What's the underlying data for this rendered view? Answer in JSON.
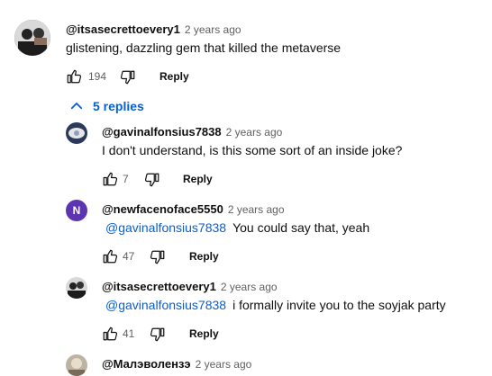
{
  "main_comment": {
    "author": "@itsasecrettoevery1",
    "time": "2 years ago",
    "text": "glistening, dazzling gem that killed the metaverse",
    "likes": "194",
    "reply_label": "Reply"
  },
  "replies_toggle": {
    "label": "5 replies"
  },
  "replies": [
    {
      "author": "@gavinalfonsius7838",
      "time": "2 years ago",
      "mention": "",
      "text": "I don't understand, is this some sort of an inside joke?",
      "likes": "7",
      "reply_label": "Reply",
      "avatar_letter": ""
    },
    {
      "author": "@newfacenoface5550",
      "time": "2 years ago",
      "mention": "@gavinalfonsius7838",
      "text": "You could say that, yeah",
      "likes": "47",
      "reply_label": "Reply",
      "avatar_letter": "N"
    },
    {
      "author": "@itsasecrettoevery1",
      "time": "2 years ago",
      "mention": "@gavinalfonsius7838",
      "text": "i formally invite you to the soyjak party",
      "likes": "41",
      "reply_label": "Reply",
      "avatar_letter": ""
    },
    {
      "author": "@Малэволензэ",
      "time": "2 years ago"
    }
  ],
  "colors": {
    "link": "#065fd4",
    "secondary_text": "#606060",
    "avatar_n": "#5e35b1"
  }
}
